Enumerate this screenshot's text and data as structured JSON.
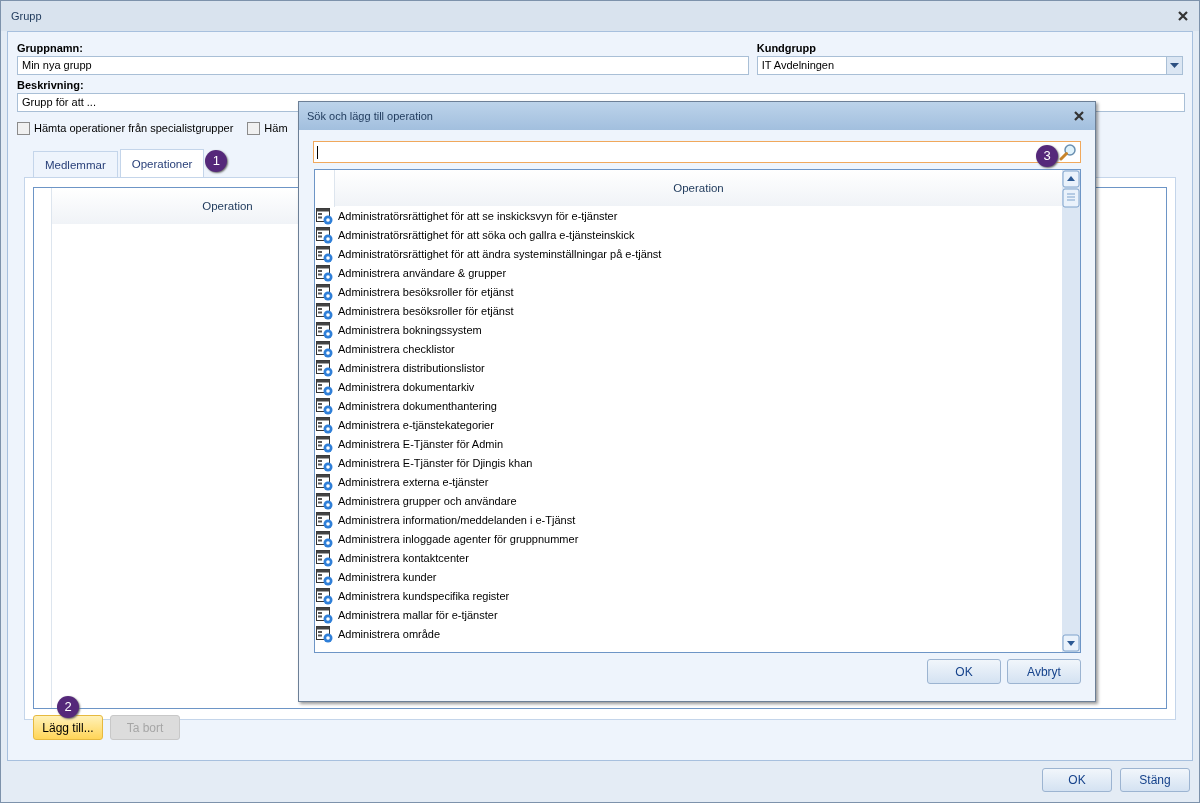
{
  "window": {
    "title": "Grupp"
  },
  "fields": [
    {
      "label": "Gruppnamn:",
      "value": "Min nya grupp"
    },
    {
      "label": "Kundgrupp",
      "value": "IT Avdelningen",
      "kind": "combo"
    },
    {
      "label": "Beskrivning:",
      "value": "Grupp för att ..."
    }
  ],
  "checkboxes": [
    {
      "label": "Hämta operationer från specialistgrupper",
      "checked": false
    },
    {
      "label": "Häm",
      "checked": false
    }
  ],
  "tabs": [
    {
      "label": "Medlemmar",
      "selected": false
    },
    {
      "label": "Operationer",
      "selected": true,
      "marker": "1"
    }
  ],
  "table": {
    "columns": [
      "Operation"
    ]
  },
  "tab_buttons": [
    {
      "label": "Lägg till...",
      "disabled": false,
      "highlighted": true,
      "marker": "2"
    },
    {
      "label": "Ta bort",
      "disabled": true,
      "highlighted": false
    }
  ],
  "footer_buttons": [
    "OK",
    "Stäng"
  ],
  "dialog": {
    "title": "Sök och lägg till operation",
    "search": {
      "marker": "3"
    },
    "columns": [
      "Operation"
    ],
    "rows": [
      "Administratörsrättighet för att se inskicksvyn för e-tjänster",
      "Administratörsrättighet för att söka och gallra e-tjänsteinskick",
      "Administratörsrättighet för att ändra systeminställningar på e-tjänst",
      "Administrera användare & grupper",
      "Administrera besöksroller för etjänst",
      "Administrera besöksroller för etjänst",
      "Administrera bokningssystem",
      "Administrera checklistor",
      "Administrera distributionslistor",
      "Administrera dokumentarkiv",
      "Administrera dokumenthantering",
      "Administrera e-tjänstekategorier",
      "Administrera E-Tjänster för Admin",
      "Administrera E-Tjänster för Djingis khan",
      "Administrera externa e-tjänster",
      "Administrera grupper och användare",
      "Administrera information/meddelanden i e-Tjänst",
      "Administrera inloggade agenter för gruppnummer",
      "Administrera kontaktcenter",
      "Administrera kunder",
      "Administrera kundspecifika register",
      "Administrera mallar för e-tjänster",
      "Administrera område"
    ],
    "buttons": [
      "OK",
      "Avbryt"
    ]
  }
}
